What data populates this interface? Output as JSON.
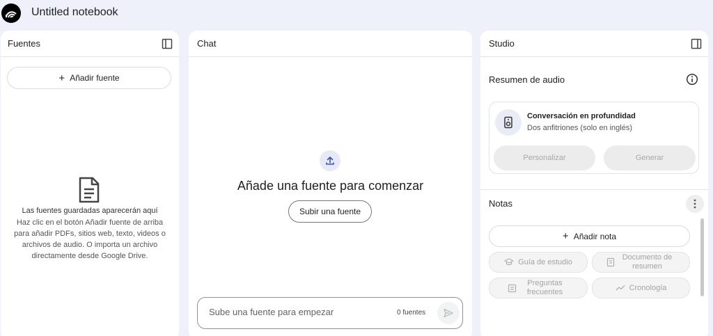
{
  "app": {
    "notebook_title": "Untitled notebook"
  },
  "sources": {
    "title": "Fuentes",
    "add_label": "Añadir fuente",
    "empty_title": "Las fuentes guardadas aparecerán aquí",
    "empty_text": "Haz clic en el botón Añadir fuente de arriba para añadir PDFs, sitios web, texto, videos o archivos de audio. O importa un archivo directamente desde Google Drive."
  },
  "chat": {
    "title": "Chat",
    "empty_title": "Añade una fuente para comenzar",
    "upload_label": "Subir una fuente",
    "input_placeholder": "Sube una fuente para empezar",
    "source_count": "0 fuentes"
  },
  "studio": {
    "title": "Studio",
    "audio_section": "Resumen de audio",
    "audio_card": {
      "title": "Conversación en profundidad",
      "subtitle": "Dos anfitriones (solo en inglés)",
      "customize_label": "Personalizar",
      "generate_label": "Generar"
    },
    "notes_section": "Notas",
    "add_note_label": "Añadir nota",
    "note_buttons": {
      "study_guide": "Guía de estudio",
      "summary_doc": "Documento de resumen",
      "faq": "Preguntas frecuentes",
      "timeline": "Cronología"
    }
  },
  "icons": {
    "logo": "notebook-logo-icon",
    "sidebar_toggle": "panel-toggle-icon",
    "document": "document-icon",
    "upload": "upload-icon",
    "send": "send-icon",
    "info": "info-icon",
    "speaker": "speaker-icon",
    "more": "more-vert-icon",
    "study": "graduation-cap-icon",
    "summary": "summary-doc-icon",
    "faq": "faq-icon",
    "timeline": "timeline-icon"
  },
  "colors": {
    "background": "#eef0fa",
    "accent": "#4a5fc1",
    "disabled_bg": "#ececec",
    "disabled_text": "#a7a7a7"
  }
}
